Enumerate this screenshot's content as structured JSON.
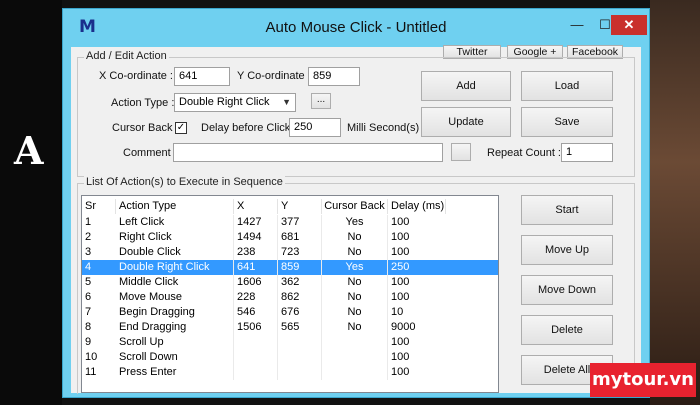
{
  "background": {
    "letter": "A"
  },
  "window": {
    "app_icon": "M",
    "title": "Auto Mouse Click - Untitled",
    "controls": {
      "minimize": "—",
      "maximize": "☐",
      "close": "✕"
    }
  },
  "social": {
    "twitter": "Twitter",
    "google": "Google +",
    "facebook": "Facebook"
  },
  "edit": {
    "group_label": "Add / Edit Action",
    "x_label": "X Co-ordinate :",
    "x_value": "641",
    "y_label": "Y Co-ordinate :",
    "y_value": "859",
    "action_type_label": "Action Type :",
    "action_type_value": "Double Right Click",
    "browse_label": "...",
    "cursor_back_label": "Cursor Back :",
    "cursor_back_checked": "✓",
    "delay_label": "Delay before Click :",
    "delay_value": "250",
    "delay_unit": "Milli Second(s)",
    "comment_label": "Comment :",
    "comment_value": "",
    "repeat_label": "Repeat Count :",
    "repeat_value": "1"
  },
  "buttons": {
    "add": "Add",
    "load": "Load",
    "update": "Update",
    "save": "Save",
    "start": "Start",
    "move_up": "Move Up",
    "move_down": "Move Down",
    "delete": "Delete",
    "delete_all": "Delete All"
  },
  "list": {
    "group_label": "List Of Action(s) to Execute in Sequence",
    "columns": [
      "Sr",
      "Action Type",
      "X",
      "Y",
      "Cursor Back",
      "Delay (ms)"
    ],
    "rows": [
      [
        "1",
        "Left Click",
        "1427",
        "377",
        "Yes",
        "100"
      ],
      [
        "2",
        "Right Click",
        "1494",
        "681",
        "No",
        "100"
      ],
      [
        "3",
        "Double Click",
        "238",
        "723",
        "No",
        "100"
      ],
      [
        "4",
        "Double Right Click",
        "641",
        "859",
        "Yes",
        "250"
      ],
      [
        "5",
        "Middle Click",
        "1606",
        "362",
        "No",
        "100"
      ],
      [
        "6",
        "Move Mouse",
        "228",
        "862",
        "No",
        "100"
      ],
      [
        "7",
        "Begin Dragging",
        "546",
        "676",
        "No",
        "10"
      ],
      [
        "8",
        "End Dragging",
        "1506",
        "565",
        "No",
        "9000"
      ],
      [
        "9",
        "Scroll Up",
        "",
        "",
        "",
        "100"
      ],
      [
        "10",
        "Scroll Down",
        "",
        "",
        "",
        "100"
      ],
      [
        "11",
        "Press Enter",
        "",
        "",
        "",
        "100"
      ]
    ],
    "selected_index": 3
  },
  "watermark": "mytour.vn",
  "colors": {
    "titlebar": "#6fd0f0",
    "selection": "#3399ff",
    "close": "#c9302c",
    "watermark": "#e8222f"
  }
}
